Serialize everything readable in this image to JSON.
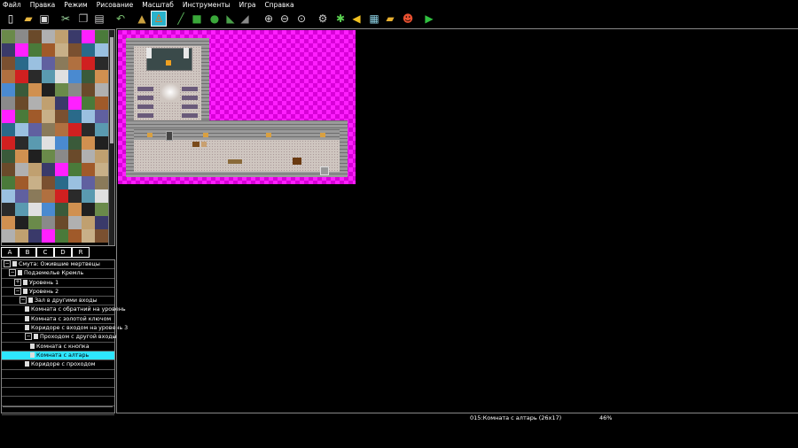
{
  "menu": [
    "Файл",
    "Правка",
    "Режим",
    "Рисование",
    "Масштаб",
    "Инструменты",
    "Игра",
    "Справка"
  ],
  "toolbar": {
    "buttons": [
      {
        "name": "new-file-icon",
        "glyph": "▯",
        "color": "#ffffff"
      },
      {
        "name": "open-folder-icon",
        "glyph": "▰",
        "color": "#e8b640"
      },
      {
        "name": "save-icon",
        "glyph": "▣",
        "color": "#d8d8d8"
      },
      {
        "name": "cut-icon",
        "glyph": "✂",
        "color": "#9fd8a0"
      },
      {
        "name": "copy-icon",
        "glyph": "❐",
        "color": "#bbbbbb"
      },
      {
        "name": "paste-icon",
        "glyph": "▤",
        "color": "#cccccc"
      },
      {
        "name": "undo-icon",
        "glyph": "↶",
        "color": "#7ac070"
      },
      {
        "name": "layer-lower-icon",
        "glyph": "▲",
        "color": "#c9a040"
      },
      {
        "name": "layer-upper-icon",
        "glyph": "▲",
        "color": "#b08a2a"
      },
      {
        "name": "event-layer-icon",
        "glyph": "♙",
        "color": "#ff6a00"
      },
      {
        "name": "pencil-icon",
        "glyph": "╱",
        "color": "#5ab35a"
      },
      {
        "name": "rectangle-icon",
        "glyph": "■",
        "color": "#3aa83a"
      },
      {
        "name": "ellipse-icon",
        "glyph": "●",
        "color": "#3aa83a"
      },
      {
        "name": "fill-icon",
        "glyph": "◣",
        "color": "#4aa04a"
      },
      {
        "name": "select-icon",
        "glyph": "◢",
        "color": "#8a8a8a"
      },
      {
        "name": "zoom-in-icon",
        "glyph": "⊕",
        "color": "#d8d8d8"
      },
      {
        "name": "zoom-out-icon",
        "glyph": "⊖",
        "color": "#d8d8d8"
      },
      {
        "name": "zoom-fit-icon",
        "glyph": "⊙",
        "color": "#d8d8d8"
      },
      {
        "name": "settings-icon",
        "glyph": "⚙",
        "color": "#cccccc"
      },
      {
        "name": "plugin-icon",
        "glyph": "✱",
        "color": "#5ad050"
      },
      {
        "name": "sound-icon",
        "glyph": "◀",
        "color": "#f0c020"
      },
      {
        "name": "picture-icon",
        "glyph": "▦",
        "color": "#8acde0"
      },
      {
        "name": "folder-database-icon",
        "glyph": "▰",
        "color": "#e8b030"
      },
      {
        "name": "character-icon",
        "glyph": "☻",
        "color": "#e85030"
      },
      {
        "name": "play-icon",
        "glyph": "▶",
        "color": "#30c040"
      }
    ],
    "active": "event-layer-icon"
  },
  "layer_tabs": [
    "A",
    "B",
    "C",
    "D",
    "R"
  ],
  "tree": [
    {
      "label": "Смута: Ожившие мертвецы",
      "indent": 0,
      "type": "folder",
      "exp": "⊟"
    },
    {
      "label": "Подземелье Кремль",
      "indent": 1,
      "type": "folder",
      "exp": "⊟"
    },
    {
      "label": "Уровень 1",
      "indent": 2,
      "type": "folder",
      "exp": "⊞"
    },
    {
      "label": "Уровень 2",
      "indent": 2,
      "type": "folder",
      "exp": "⊟"
    },
    {
      "label": "Зал в другими входы",
      "indent": 3,
      "type": "folder",
      "exp": "⊟"
    },
    {
      "label": "Комната с обратний на уровень",
      "indent": 4,
      "type": "doc",
      "exp": ""
    },
    {
      "label": "Комната с золотой ключом",
      "indent": 4,
      "type": "doc",
      "exp": ""
    },
    {
      "label": "Коридоре с входом на уровень 3",
      "indent": 4,
      "type": "doc",
      "exp": ""
    },
    {
      "label": "Проходом с другой входы",
      "indent": 4,
      "type": "folder",
      "exp": "⊟"
    },
    {
      "label": "Комната с кнопка",
      "indent": 5,
      "type": "doc",
      "exp": ""
    },
    {
      "label": "Комната с алтарь",
      "indent": 5,
      "type": "doc",
      "exp": "",
      "selected": true
    },
    {
      "label": "Коридоре с проходом",
      "indent": 4,
      "type": "doc",
      "exp": ""
    }
  ],
  "status": {
    "room": "015:Комната с алтарь (26x17)",
    "zoom": "46%"
  },
  "colors": {
    "transparent_tile": "#ff1fff",
    "selection": "#2ee6ff",
    "active_tool": "#2ab3cc"
  }
}
